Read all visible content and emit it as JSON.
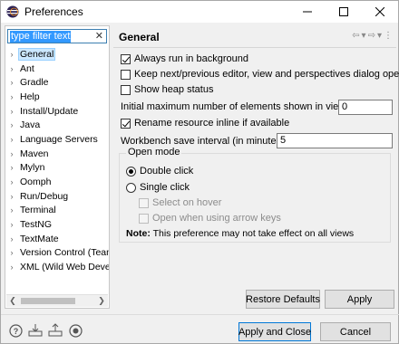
{
  "window": {
    "title": "Preferences",
    "minimize_label": "—",
    "maximize_label": "☐",
    "close_label": "✕"
  },
  "filter": {
    "value": "type filter text",
    "clear_label": "✕"
  },
  "tree": {
    "items": [
      {
        "label": "General",
        "selected": true
      },
      {
        "label": "Ant"
      },
      {
        "label": "Gradle"
      },
      {
        "label": "Help"
      },
      {
        "label": "Install/Update"
      },
      {
        "label": "Java"
      },
      {
        "label": "Language Servers"
      },
      {
        "label": "Maven"
      },
      {
        "label": "Mylyn"
      },
      {
        "label": "Oomph"
      },
      {
        "label": "Run/Debug"
      },
      {
        "label": "Terminal"
      },
      {
        "label": "TestNG"
      },
      {
        "label": "TextMate"
      },
      {
        "label": "Version Control (Team)"
      },
      {
        "label": "XML (Wild Web Developer)"
      }
    ]
  },
  "page": {
    "title": "General",
    "options": {
      "always_run_background": {
        "label": "Always run in background",
        "checked": true
      },
      "keep_next_prev": {
        "label": "Keep next/previous editor, view and perspectives dialog open",
        "checked": false
      },
      "show_heap": {
        "label": "Show heap status",
        "checked": false
      },
      "rename_inline": {
        "label": "Rename resource inline if available",
        "checked": true
      }
    },
    "max_elements": {
      "label": "Initial maximum number of elements shown in views:",
      "value": "0"
    },
    "save_interval": {
      "label": "Workbench save interval (in minutes):",
      "value": "5"
    },
    "open_mode": {
      "group_label": "Open mode",
      "double_click": "Double click",
      "single_click": "Single click",
      "select_on_hover": "Select on hover",
      "open_arrow_keys": "Open when using arrow keys",
      "selected": "double_click"
    },
    "note_bold": "Note:",
    "note_text": " This preference may not take effect on all views"
  },
  "buttons": {
    "restore_defaults": "Restore Defaults",
    "apply": "Apply",
    "apply_and_close": "Apply and Close",
    "cancel": "Cancel"
  },
  "colors": {
    "accent": "#0078d7",
    "selection": "#cce8ff",
    "filter_highlight": "#3399ff"
  },
  "icons": [
    "help-icon",
    "import-icon",
    "export-icon",
    "record-icon"
  ]
}
